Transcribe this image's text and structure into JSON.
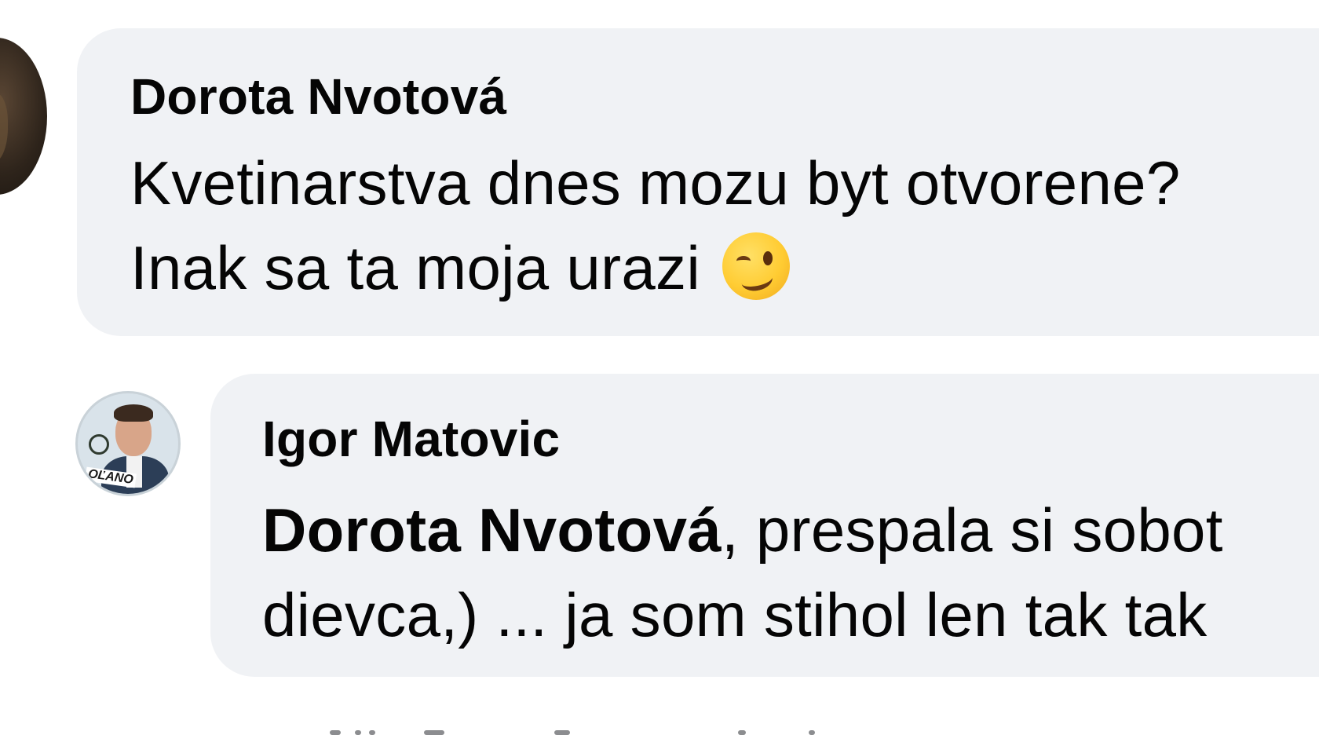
{
  "comments": [
    {
      "author": "Dorota Nvotová",
      "lines": [
        "Kvetinarstva dnes mozu byt otvorene?",
        "Inak sa ta moja urazi"
      ],
      "emoji": "winking-face"
    }
  ],
  "reply": {
    "author": "Igor Matovic",
    "avatar_badge": "OĽANO",
    "mention": "Dorota Nvotová",
    "line_1_rest": ", prespala si sobot",
    "line_2": "dievca,) ... ja som stihol len tak tak"
  },
  "colors": {
    "bubble_background": "#f0f2f5",
    "text": "#050505",
    "page_background": "#ffffff"
  }
}
